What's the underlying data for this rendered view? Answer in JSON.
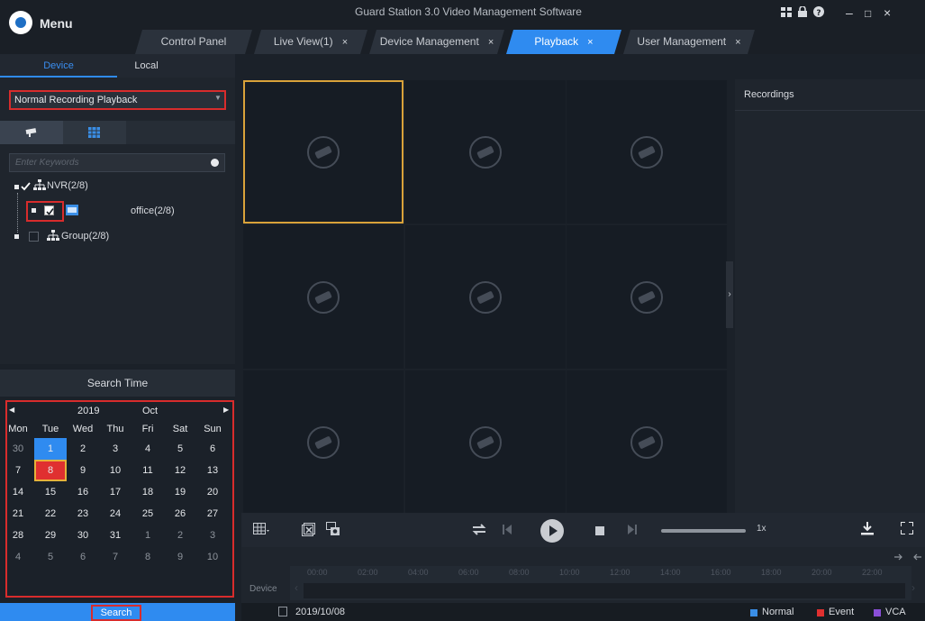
{
  "app": {
    "menu_label": "Menu",
    "title": "Guard Station 3.0 Video Management Software",
    "window_controls": [
      "–",
      "□",
      "×"
    ],
    "toolbar_icons": [
      "layout-icon",
      "lock-icon",
      "help-icon"
    ]
  },
  "tabs": [
    {
      "label": "Control Panel",
      "closable": false,
      "active": false
    },
    {
      "label": "Live View(1)",
      "closable": true,
      "active": false
    },
    {
      "label": "Device Management",
      "closable": true,
      "active": false
    },
    {
      "label": "Playback",
      "closable": true,
      "active": true
    },
    {
      "label": "User Management",
      "closable": true,
      "active": false
    }
  ],
  "tab_close": "×",
  "left": {
    "subtabs": {
      "device": "Device",
      "local": "Local"
    },
    "mode_select": "Normal Recording Playback",
    "search_placeholder": "Enter Keywords",
    "tree": {
      "nvr": "NVR(2/8)",
      "office": "office(2/8)",
      "group": "Group(2/8)"
    },
    "search_time_label": "Search Time",
    "calendar": {
      "year": "2019",
      "month": "Oct",
      "weekdays": [
        "Mon",
        "Tue",
        "Wed",
        "Thu",
        "Fri",
        "Sat",
        "Sun"
      ],
      "rows": [
        [
          "30",
          "1",
          "2",
          "3",
          "4",
          "5",
          "6"
        ],
        [
          "7",
          "8",
          "9",
          "10",
          "11",
          "12",
          "13"
        ],
        [
          "14",
          "15",
          "16",
          "17",
          "18",
          "19",
          "20"
        ],
        [
          "21",
          "22",
          "23",
          "24",
          "25",
          "26",
          "27"
        ],
        [
          "28",
          "29",
          "30",
          "31",
          "1",
          "2",
          "3"
        ],
        [
          "4",
          "5",
          "6",
          "7",
          "8",
          "9",
          "10"
        ]
      ],
      "today": "1",
      "selected": "8"
    },
    "search_button": "Search"
  },
  "recordings_title": "Recordings",
  "controls": {
    "speed": "1x"
  },
  "timeline": {
    "device_label": "Device",
    "ticks": [
      "00:00",
      "02:00",
      "04:00",
      "06:00",
      "08:00",
      "10:00",
      "12:00",
      "14:00",
      "16:00",
      "18:00",
      "20:00",
      "22:00"
    ]
  },
  "status": {
    "date": "2019/10/08",
    "legend": [
      {
        "label": "Normal",
        "color": "#3a8ee6"
      },
      {
        "label": "Event",
        "color": "#e03030"
      },
      {
        "label": "VCA",
        "color": "#8a4fd8"
      }
    ]
  }
}
